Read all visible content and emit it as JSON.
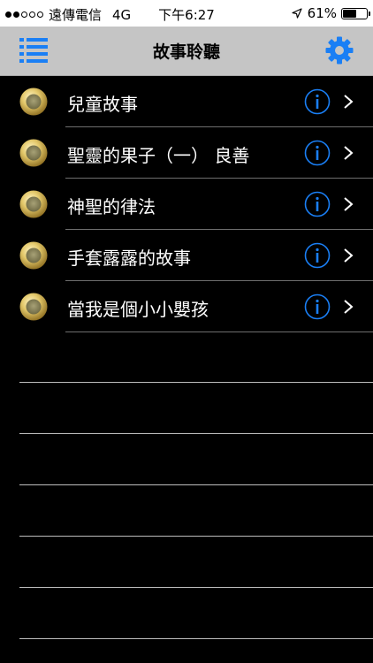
{
  "status_bar": {
    "carrier": "遠傳電信",
    "network": "4G",
    "time": "下午6:27",
    "battery_percent": "61%",
    "battery_level": 0.61,
    "signal_bars_filled": 2,
    "signal_bars_total": 5
  },
  "nav": {
    "title": "故事聆聽",
    "menu_icon": "list-icon",
    "settings_icon": "gear-icon",
    "accent_color": "#1a7ff5"
  },
  "list": {
    "items": [
      {
        "label": "兒童故事"
      },
      {
        "label": "聖靈的果子（一） 良善"
      },
      {
        "label": "神聖的律法"
      },
      {
        "label": "手套露露的故事"
      },
      {
        "label": "當我是個小小嬰孩"
      }
    ]
  }
}
